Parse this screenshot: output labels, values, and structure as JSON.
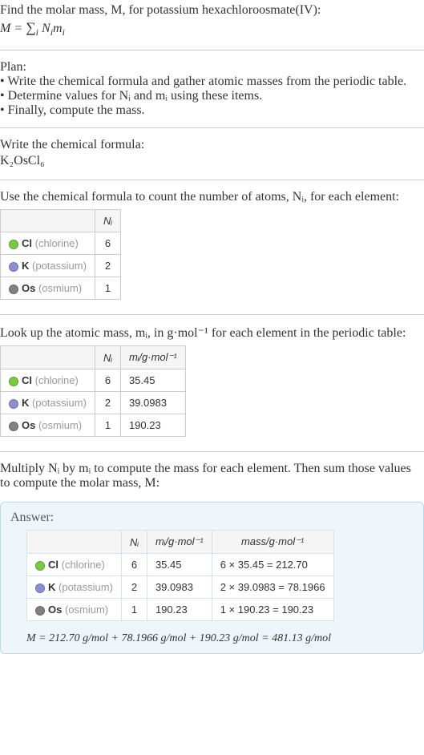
{
  "intro": {
    "line1": "Find the molar mass, M, for potassium hexachloroosmate(IV):",
    "formula_html": "M = ∑ Nᵢmᵢ",
    "sum_sub": "i"
  },
  "plan": {
    "heading": "Plan:",
    "b1": "• Write the chemical formula and gather atomic masses from the periodic table.",
    "b2": "• Determine values for Nᵢ and mᵢ using these items.",
    "b3": "• Finally, compute the mass."
  },
  "chem": {
    "heading": "Write the chemical formula:",
    "formula": "K₂OsCl₆"
  },
  "count": {
    "heading": "Use the chemical formula to count the number of atoms, Nᵢ, for each element:",
    "header_ni": "Nᵢ",
    "rows": [
      {
        "dot": "#7ac943",
        "sym": "Cl",
        "name": "(chlorine)",
        "n": "6"
      },
      {
        "dot": "#8e8ecf",
        "sym": "K",
        "name": "(potassium)",
        "n": "2"
      },
      {
        "dot": "#808080",
        "sym": "Os",
        "name": "(osmium)",
        "n": "1"
      }
    ]
  },
  "mass": {
    "heading": "Look up the atomic mass, mᵢ, in g·mol⁻¹ for each element in the periodic table:",
    "header_ni": "Nᵢ",
    "header_mi": "mᵢ/g·mol⁻¹",
    "rows": [
      {
        "dot": "#7ac943",
        "sym": "Cl",
        "name": "(chlorine)",
        "n": "6",
        "m": "35.45"
      },
      {
        "dot": "#8e8ecf",
        "sym": "K",
        "name": "(potassium)",
        "n": "2",
        "m": "39.0983"
      },
      {
        "dot": "#808080",
        "sym": "Os",
        "name": "(osmium)",
        "n": "1",
        "m": "190.23"
      }
    ]
  },
  "multiply": {
    "heading": "Multiply Nᵢ by mᵢ to compute the mass for each element. Then sum those values to compute the molar mass, M:"
  },
  "answer": {
    "label": "Answer:",
    "header_ni": "Nᵢ",
    "header_mi": "mᵢ/g·mol⁻¹",
    "header_mass": "mass/g·mol⁻¹",
    "rows": [
      {
        "dot": "#7ac943",
        "sym": "Cl",
        "name": "(chlorine)",
        "n": "6",
        "m": "35.45",
        "calc": "6 × 35.45 = 212.70"
      },
      {
        "dot": "#8e8ecf",
        "sym": "K",
        "name": "(potassium)",
        "n": "2",
        "m": "39.0983",
        "calc": "2 × 39.0983 = 78.1966"
      },
      {
        "dot": "#808080",
        "sym": "Os",
        "name": "(osmium)",
        "n": "1",
        "m": "190.23",
        "calc": "1 × 190.23 = 190.23"
      }
    ],
    "result": "M = 212.70 g/mol + 78.1966 g/mol + 190.23 g/mol = 481.13 g/mol"
  }
}
